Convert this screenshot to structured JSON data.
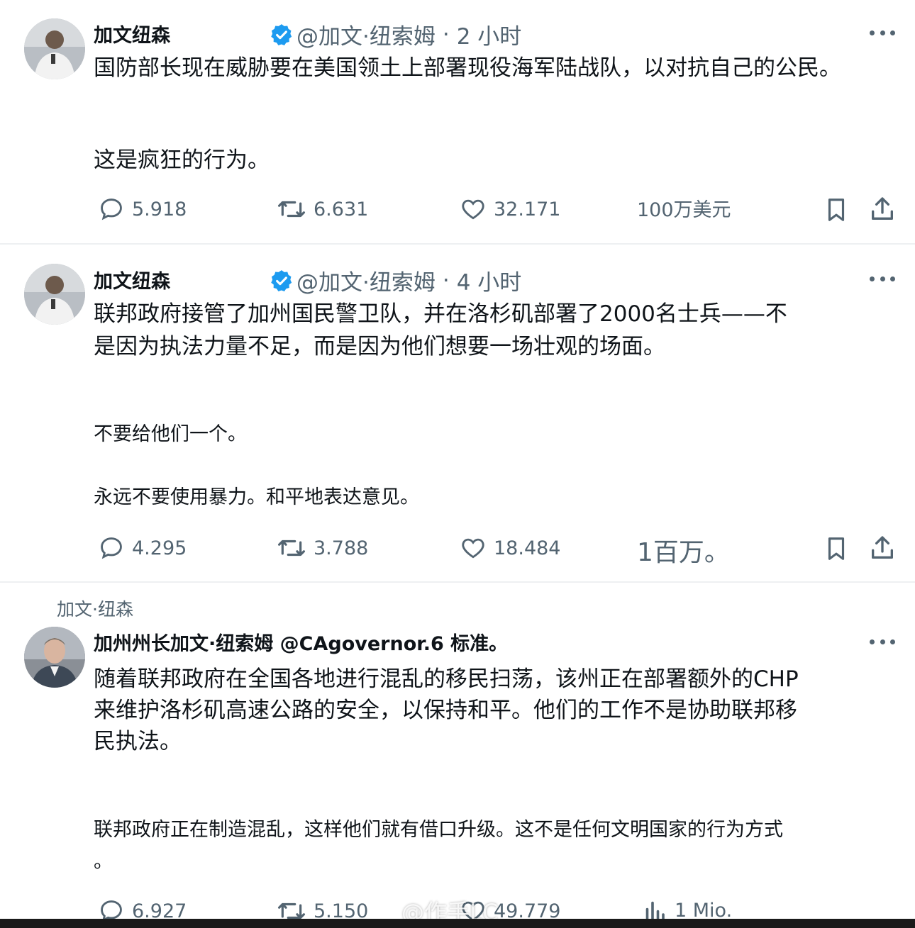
{
  "tweets": [
    {
      "name": "加文纽森",
      "handle": "@加文·纽索姆",
      "dot": "·",
      "time": "2 小时",
      "paragraphs": [
        "国防部长现在威胁要在美国领土上部署现役海军陆战队，以对抗自己的公民。",
        "这是疯狂的行为。"
      ],
      "replies": "5.918",
      "retweets": "6.631",
      "likes": "32.171",
      "views": "100万美元"
    },
    {
      "name": "加文纽森",
      "handle": "@加文·纽索姆",
      "dot": "·",
      "time": "4 小时",
      "paragraphs": [
        "联邦政府接管了加州国民警卫队，并在洛杉矶部署了2000名士兵——不",
        "是因为执法力量不足，而是因为他们想要一场壮观的场面。",
        "不要给他们一个。",
        "永远不要使用暴力。和平地表达意见。"
      ],
      "replies": "4.295",
      "retweets": "3.788",
      "likes": "18.484",
      "views": "1百万。"
    },
    {
      "kicker": "加文·纽森",
      "name": "加州州长加文·纽索姆 @CAgovernor.6 标准。",
      "paragraphs": [
        "随着联邦政府在全国各地进行混乱的移民扫荡，该州正在部署额外的CHP",
        "来维护洛杉矶高速公路的安全，以保持和平。他们的工作不是协助联邦移",
        "民执法。",
        "联邦政府正在制造混乱，这样他们就有借口升级。这不是任何文明国家的行为方式",
        "。"
      ],
      "replies": "6.927",
      "retweets": "5.150",
      "likes": "49.779",
      "views": "1 Mio."
    }
  ],
  "watermark": "@作手LC",
  "icons": {
    "reply": "reply-icon",
    "retweet": "retweet-icon",
    "like": "heart-icon",
    "bookmark": "bookmark-icon",
    "share": "share-icon",
    "verified": "verified-badge-icon",
    "more": "more-dots-icon",
    "views": "views-chart-icon"
  },
  "colors": {
    "text": "#0f1419",
    "muted": "#536471",
    "verified": "#1d9bf0"
  }
}
